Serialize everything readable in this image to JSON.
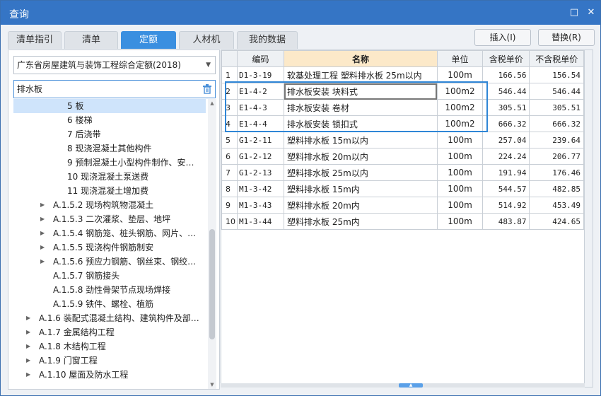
{
  "window": {
    "title": "查询",
    "restore_glyph": "□",
    "close_glyph": "✕"
  },
  "tabs": [
    {
      "label": "清单指引",
      "active": false
    },
    {
      "label": "清单",
      "active": false
    },
    {
      "label": "定额",
      "active": true
    },
    {
      "label": "人材机",
      "active": false
    },
    {
      "label": "我的数据",
      "active": false
    }
  ],
  "actions": {
    "insert_label": "插入(I)",
    "replace_label": "替换(R)"
  },
  "left": {
    "library_select": "广东省房屋建筑与装饰工程综合定额(2018)",
    "search_value": "排水板",
    "tree": [
      {
        "label": "5 板",
        "indent": 2,
        "caret": false,
        "selected": true
      },
      {
        "label": "6 楼梯",
        "indent": 2,
        "caret": false
      },
      {
        "label": "7 后浇带",
        "indent": 2,
        "caret": false
      },
      {
        "label": "8 现浇混凝土其他构件",
        "indent": 2,
        "caret": false
      },
      {
        "label": "9 预制混凝土小型构件制作、安…",
        "indent": 2,
        "caret": false
      },
      {
        "label": "10 现浇混凝土泵送费",
        "indent": 2,
        "caret": false
      },
      {
        "label": "11 现浇混凝土增加费",
        "indent": 2,
        "caret": false
      },
      {
        "label": "A.1.5.2 现场构筑物混凝土",
        "indent": 1,
        "caret": true
      },
      {
        "label": "A.1.5.3 二次灌浆、垫层、地坪",
        "indent": 1,
        "caret": true
      },
      {
        "label": "A.1.5.4 钢筋笼、桩头钢筋、网片、…",
        "indent": 1,
        "caret": true
      },
      {
        "label": "A.1.5.5 现浇构件钢筋制安",
        "indent": 1,
        "caret": true
      },
      {
        "label": "A.1.5.6 预应力钢筋、钢丝束、钢绞…",
        "indent": 1,
        "caret": true
      },
      {
        "label": "A.1.5.7 钢筋接头",
        "indent": 1,
        "caret": false
      },
      {
        "label": "A.1.5.8 劲性骨架节点现场焊接",
        "indent": 1,
        "caret": false
      },
      {
        "label": "A.1.5.9 铁件、螺栓、植筋",
        "indent": 1,
        "caret": false
      },
      {
        "label": "A.1.6 装配式混凝土结构、建筑构件及部…",
        "indent": 0,
        "caret": true
      },
      {
        "label": "A.1.7 金属结构工程",
        "indent": 0,
        "caret": true
      },
      {
        "label": "A.1.8 木结构工程",
        "indent": 0,
        "caret": true
      },
      {
        "label": "A.1.9 门窗工程",
        "indent": 0,
        "caret": true
      },
      {
        "label": "A.1.10 屋面及防水工程",
        "indent": 0,
        "caret": true
      }
    ]
  },
  "table": {
    "headers": {
      "idx": "",
      "code": "编码",
      "name": "名称",
      "unit": "单位",
      "tax": "含税单价",
      "notax": "不含税单价"
    },
    "rows": [
      {
        "idx": "1",
        "code": "D1-3-19",
        "name": "软基处理工程 塑料排水板 25m以内",
        "unit": "100m",
        "tax": "166.56",
        "notax": "156.54"
      },
      {
        "idx": "2",
        "code": "E1-4-2",
        "name": "排水板安装 块料式",
        "unit": "100m2",
        "tax": "546.44",
        "notax": "546.44"
      },
      {
        "idx": "3",
        "code": "E1-4-3",
        "name": "排水板安装 卷材",
        "unit": "100m2",
        "tax": "305.51",
        "notax": "305.51"
      },
      {
        "idx": "4",
        "code": "E1-4-4",
        "name": "排水板安装 锁扣式",
        "unit": "100m2",
        "tax": "666.32",
        "notax": "666.32"
      },
      {
        "idx": "5",
        "code": "G1-2-11",
        "name": "塑料排水板 15m以内",
        "unit": "100m",
        "tax": "257.04",
        "notax": "239.64"
      },
      {
        "idx": "6",
        "code": "G1-2-12",
        "name": "塑料排水板 20m以内",
        "unit": "100m",
        "tax": "224.24",
        "notax": "206.77"
      },
      {
        "idx": "7",
        "code": "G1-2-13",
        "name": "塑料排水板 25m以内",
        "unit": "100m",
        "tax": "191.94",
        "notax": "176.46"
      },
      {
        "idx": "8",
        "code": "M1-3-42",
        "name": "塑料排水板 15m内",
        "unit": "100m",
        "tax": "544.57",
        "notax": "482.85"
      },
      {
        "idx": "9",
        "code": "M1-3-43",
        "name": "塑料排水板 20m内",
        "unit": "100m",
        "tax": "514.92",
        "notax": "453.49"
      },
      {
        "idx": "10",
        "code": "M1-3-44",
        "name": "塑料排水板 25m内",
        "unit": "100m",
        "tax": "483.87",
        "notax": "424.65"
      }
    ]
  }
}
